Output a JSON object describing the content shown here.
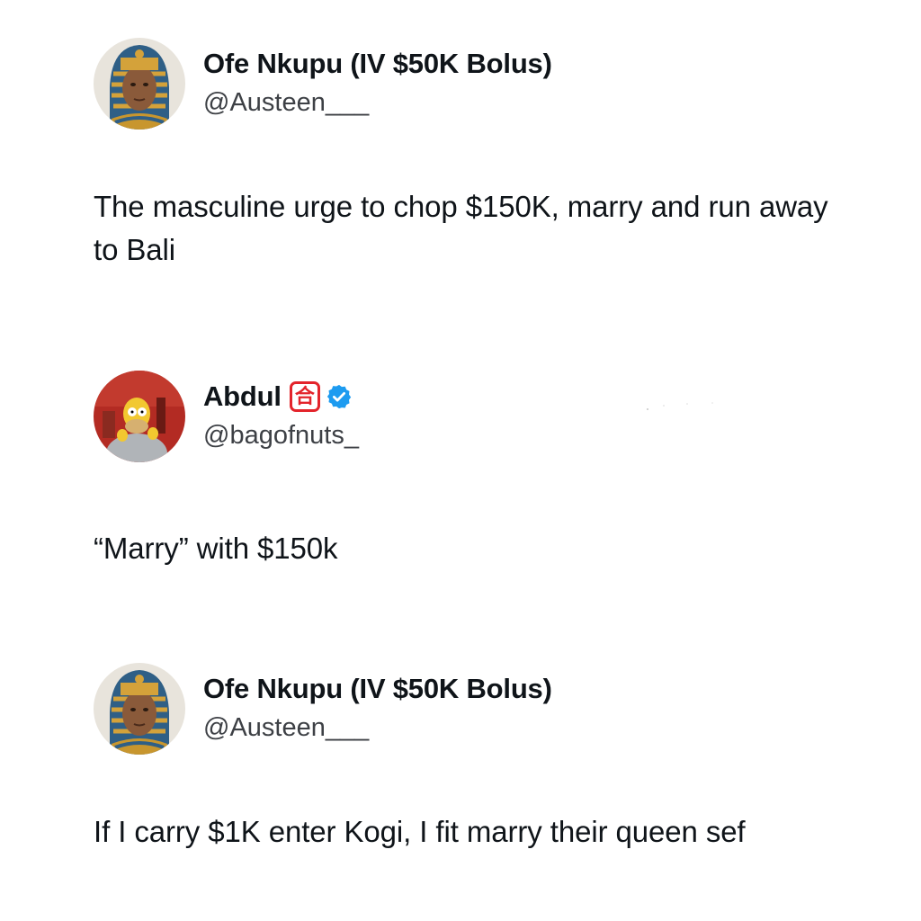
{
  "tweets": [
    {
      "display_name": "Ofe Nkupu (IV $50K Bolus)",
      "handle": "@Austeen___",
      "avatar_icon": "pharaoh-avatar",
      "text": "The masculine urge to chop $150K, marry and run away to Bali"
    },
    {
      "display_name": "Abdul",
      "name_emoji": "合",
      "verified": true,
      "handle": "@bagofnuts_",
      "avatar_icon": "cartoon-character-avatar",
      "text": "“Marry” with $150k"
    },
    {
      "display_name": "Ofe Nkupu (IV $50K Bolus)",
      "handle": "@Austeen___",
      "avatar_icon": "pharaoh-avatar",
      "text": "If I carry $1K enter Kogi, I fit marry their queen sef"
    }
  ],
  "colors": {
    "text": "#0f1419",
    "handle": "#3d4045",
    "verified": "#1d9bf0",
    "emoji_red": "#e3242b"
  }
}
